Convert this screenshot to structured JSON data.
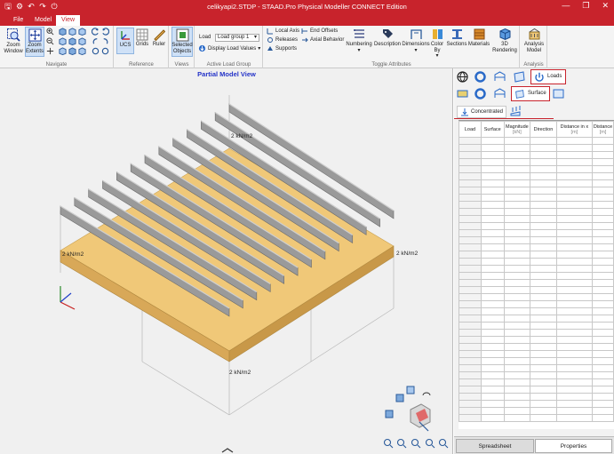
{
  "app": {
    "title": "celikyapi2.STDP - STAAD.Pro Physical Modeller CONNECT Edition",
    "quick_access_icons": [
      "save-icon",
      "settings-icon",
      "undo-icon",
      "redo-icon",
      "power-icon"
    ],
    "window_buttons": [
      "—",
      "❐",
      "✕"
    ]
  },
  "tabs": [
    {
      "label": "File"
    },
    {
      "label": "Model"
    },
    {
      "label": "View"
    }
  ],
  "ribbon": {
    "navigate": {
      "label": "Navigate",
      "zoom_window": "Zoom Window",
      "zoom_extents": "Zoom Extents"
    },
    "reference": {
      "label": "Reference",
      "ucs": "UCS",
      "grids": "Grids",
      "ruler": "Ruler"
    },
    "views": {
      "label": "Views",
      "selected_objects": "Selected Objects"
    },
    "active_load_group": {
      "label": "Active Load Group",
      "load_prefix": "Load",
      "load_group_value": "Load group 1",
      "display_load_values": "Display Load Values"
    },
    "toggle_attributes": {
      "label": "Toggle Attributes",
      "local_axis": "Local Axis",
      "releases": "Releases",
      "supports": "Supports",
      "end_offsets": "End Offsets",
      "axial_behavior": "Axial Behavior",
      "numbering": "Numbering",
      "description": "Description",
      "dimensions": "Dimensions",
      "color_by": "Color By",
      "sections": "Sections",
      "materials": "Materials",
      "rendering_3d": "3D Rendering"
    },
    "analysis": {
      "label": "Analysis",
      "analysis_model": "Analysis Model"
    }
  },
  "viewport": {
    "title": "Partial Model View",
    "load_labels": [
      "2 kN/m2",
      "2 kN/m2",
      "2 kN/m2",
      "2 kN/m2"
    ]
  },
  "panel": {
    "loads_tab": "Loads",
    "surface_tab": "Surface",
    "concentrated_tab": "Concentrated",
    "columns": [
      {
        "name": "Load",
        "unit": ""
      },
      {
        "name": "Surface",
        "unit": ""
      },
      {
        "name": "Magnitude",
        "unit": "[kN]"
      },
      {
        "name": "Direction",
        "unit": ""
      },
      {
        "name": "Distance in x",
        "unit": "[m]"
      },
      {
        "name": "Distance",
        "unit": "[m]"
      }
    ],
    "bottom_tabs": {
      "spreadsheet": "Spreadsheet",
      "properties": "Properties"
    }
  },
  "colors": {
    "brand": "#c8232c",
    "accent_blue": "#2433c8",
    "slab": "#f0c878",
    "beam": "#9a9a9a"
  }
}
